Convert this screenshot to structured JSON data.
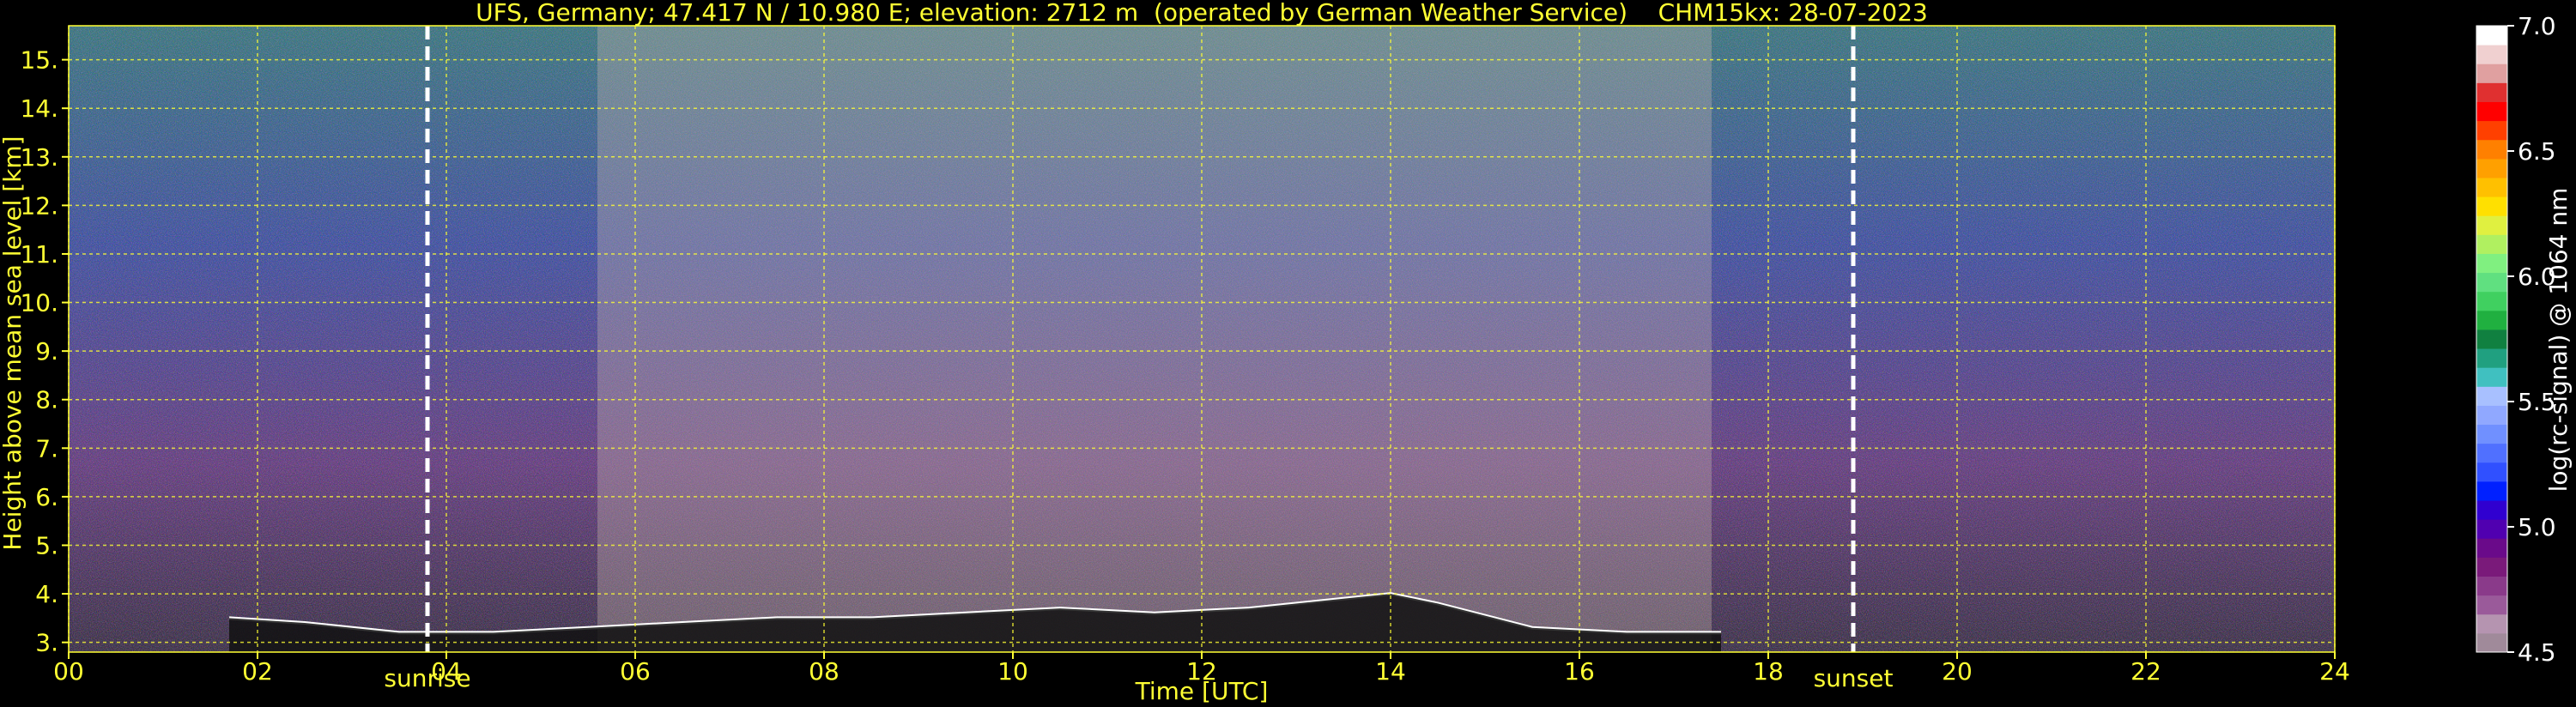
{
  "chart_data": {
    "type": "heatmap",
    "title": "UFS, Germany; 47.417 N / 10.980 E; elevation: 2712 m  (operated by German Weather Service)    CHM15kx: 28-07-2023",
    "xlabel": "Time [UTC]",
    "ylabel": "Height above mean sea level [km]",
    "xlim": [
      0,
      24
    ],
    "ylim": [
      2.8,
      15.7
    ],
    "x_ticks": [
      0,
      2,
      4,
      6,
      8,
      10,
      12,
      14,
      16,
      18,
      20,
      22,
      24
    ],
    "x_tick_labels": [
      "00",
      "02",
      "04",
      "06",
      "08",
      "10",
      "12",
      "14",
      "16",
      "18",
      "20",
      "22",
      "24"
    ],
    "y_ticks": [
      3,
      4,
      5,
      6,
      7,
      8,
      9,
      10,
      11,
      12,
      13,
      14,
      15
    ],
    "y_tick_labels": [
      "3.",
      "4.",
      "5.",
      "6.",
      "7.",
      "8.",
      "9.",
      "10.",
      "11.",
      "12.",
      "13.",
      "14.",
      "15."
    ],
    "grid": true,
    "colorbar": {
      "label": "log(rc-signal) @ 1064 nm",
      "min": 4.5,
      "max": 7.0,
      "ticks": [
        4.5,
        5.0,
        5.5,
        6.0,
        6.5,
        7.0
      ],
      "tick_labels": [
        "4.5",
        "5.0",
        "5.5",
        "6.0",
        "6.5",
        "7.0"
      ],
      "colors": [
        "#a08a9a",
        "#b594b0",
        "#9a5a9a",
        "#8a3a8a",
        "#7a1a7a",
        "#6a0a8a",
        "#5000b0",
        "#3000d0",
        "#0020ff",
        "#3050ff",
        "#5070ff",
        "#7090ff",
        "#90a8ff",
        "#a8c0ff",
        "#40c0c0",
        "#20a080",
        "#108040",
        "#20b040",
        "#40d060",
        "#60e080",
        "#80f080",
        "#b0f060",
        "#e0f040",
        "#ffe000",
        "#ffc000",
        "#ffa000",
        "#ff8000",
        "#ff4000",
        "#ff0000",
        "#e03030",
        "#e0a0a0",
        "#f0d0d0",
        "#ffffff"
      ]
    },
    "annotations": [
      {
        "x": 3.8,
        "label": "sunrise"
      },
      {
        "x": 18.9,
        "label": "sunset"
      }
    ],
    "boundary_layer_top_km": {
      "x": [
        1.7,
        2.5,
        3.5,
        4.5,
        5.5,
        6.5,
        7.5,
        8.5,
        9.5,
        10.5,
        11.5,
        12.5,
        13.5,
        14.0,
        14.5,
        15.5,
        16.5,
        17.5
      ],
      "y": [
        3.5,
        3.4,
        3.2,
        3.2,
        3.3,
        3.4,
        3.5,
        3.5,
        3.6,
        3.7,
        3.6,
        3.7,
        3.9,
        4.0,
        3.8,
        3.3,
        3.2,
        3.2
      ]
    }
  }
}
